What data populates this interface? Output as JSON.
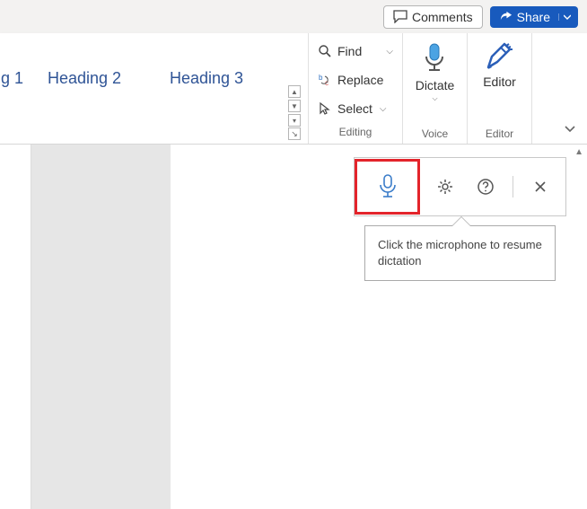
{
  "topbar": {
    "comments_label": "Comments",
    "share_label": "Share"
  },
  "styles": {
    "heading1": "g 1",
    "heading2": "Heading 2",
    "heading3": "Heading 3"
  },
  "editing": {
    "find": "Find",
    "replace": "Replace",
    "select": "Select",
    "group_label": "Editing"
  },
  "voice": {
    "dictate": "Dictate",
    "group_label": "Voice"
  },
  "editor": {
    "editor": "Editor",
    "group_label": "Editor"
  },
  "dictation_tooltip": "Click the microphone to resume dictation"
}
